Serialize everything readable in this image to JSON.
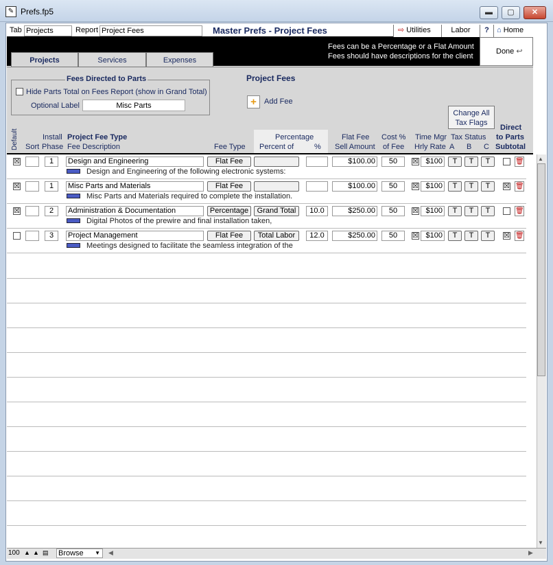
{
  "window": {
    "title": "Prefs.fp5",
    "min": "▬",
    "max": "▢",
    "close": "✕"
  },
  "header": {
    "tab_label": "Tab",
    "tab_value": "Projects",
    "report_label": "Report",
    "report_value": "Project Fees",
    "title": "Master Prefs - Project Fees",
    "utilities": "Utilities",
    "labor": "Labor",
    "help": "?",
    "home": "Home"
  },
  "notes": {
    "line1": "Fees can be a Percentage or a Flat Amount",
    "line2": "Fees should have descriptions for the client",
    "done": "Done"
  },
  "tabs": [
    "Projects",
    "Services",
    "Expenses"
  ],
  "fees_directed": {
    "title": "Fees Directed to Parts",
    "hide_label": "Hide Parts Total on Fees Report (show in Grand Total)",
    "optional_label": "Optional Label",
    "optional_value": "Misc Parts"
  },
  "project_fees": {
    "title": "Project Fees",
    "add_fee": "Add Fee",
    "change_all_1": "Change All",
    "change_all_2": "Tax Flags"
  },
  "columns": {
    "default": "Default",
    "sort": "Sort",
    "install": "Install",
    "phase": "Phase",
    "fee_type_title": "Project Fee Type",
    "fee_desc": "Fee Description",
    "fee_type": "Fee Type",
    "percentage": "Percentage",
    "percent_of": "Percent of",
    "pct": "%",
    "flat_fee": "Flat Fee",
    "sell_amount": "Sell Amount",
    "cost_pct": "Cost %",
    "of_fee": "of Fee",
    "time_mgr": "Time Mgr",
    "hrly_rate": "Hrly Rate",
    "tax_status": "Tax Status",
    "tax_a": "A",
    "tax_b": "B",
    "tax_c": "C",
    "direct": "Direct",
    "to_parts": "to Parts",
    "subtotal": "Subtotal"
  },
  "rows": [
    {
      "default": "☒",
      "phase": "1",
      "name": "Design and Engineering",
      "fee_type": "Flat Fee",
      "percent_of": "",
      "pct": "",
      "amount": "$100.00",
      "cost": "50",
      "time_mgr": "☒",
      "rate": "$100",
      "a": "T",
      "b": "T",
      "c": "T",
      "direct": "",
      "desc": "Design and Engineering of  the following electronic systems:"
    },
    {
      "default": "☒",
      "phase": "1",
      "name": "Misc Parts and Materials",
      "fee_type": "Flat Fee",
      "percent_of": "",
      "pct": "",
      "amount": "$100.00",
      "cost": "50",
      "time_mgr": "☒",
      "rate": "$100",
      "a": "T",
      "b": "T",
      "c": "T",
      "direct": "☒",
      "desc": "Misc Parts and Materials required to complete the installation."
    },
    {
      "default": "☒",
      "phase": "2",
      "name": "Administration & Documentation",
      "fee_type": "Percentage",
      "percent_of": "Grand Total",
      "pct": "10.0",
      "amount": "$250.00",
      "cost": "50",
      "time_mgr": "☒",
      "rate": "$100",
      "a": "T",
      "b": "T",
      "c": "T",
      "direct": "",
      "desc": "Digital Photos of the prewire and final installation taken,"
    },
    {
      "default": "",
      "phase": "3",
      "name": "Project Management",
      "fee_type": "Flat Fee",
      "percent_of": "Total Labor",
      "pct": "12.0",
      "amount": "$250.00",
      "cost": "50",
      "time_mgr": "☒",
      "rate": "$100",
      "a": "T",
      "b": "T",
      "c": "T",
      "direct": "☒",
      "desc": "Meetings designed to facilitate the seamless integration of the"
    }
  ],
  "status": {
    "zoom": "100",
    "mode": "Browse"
  }
}
